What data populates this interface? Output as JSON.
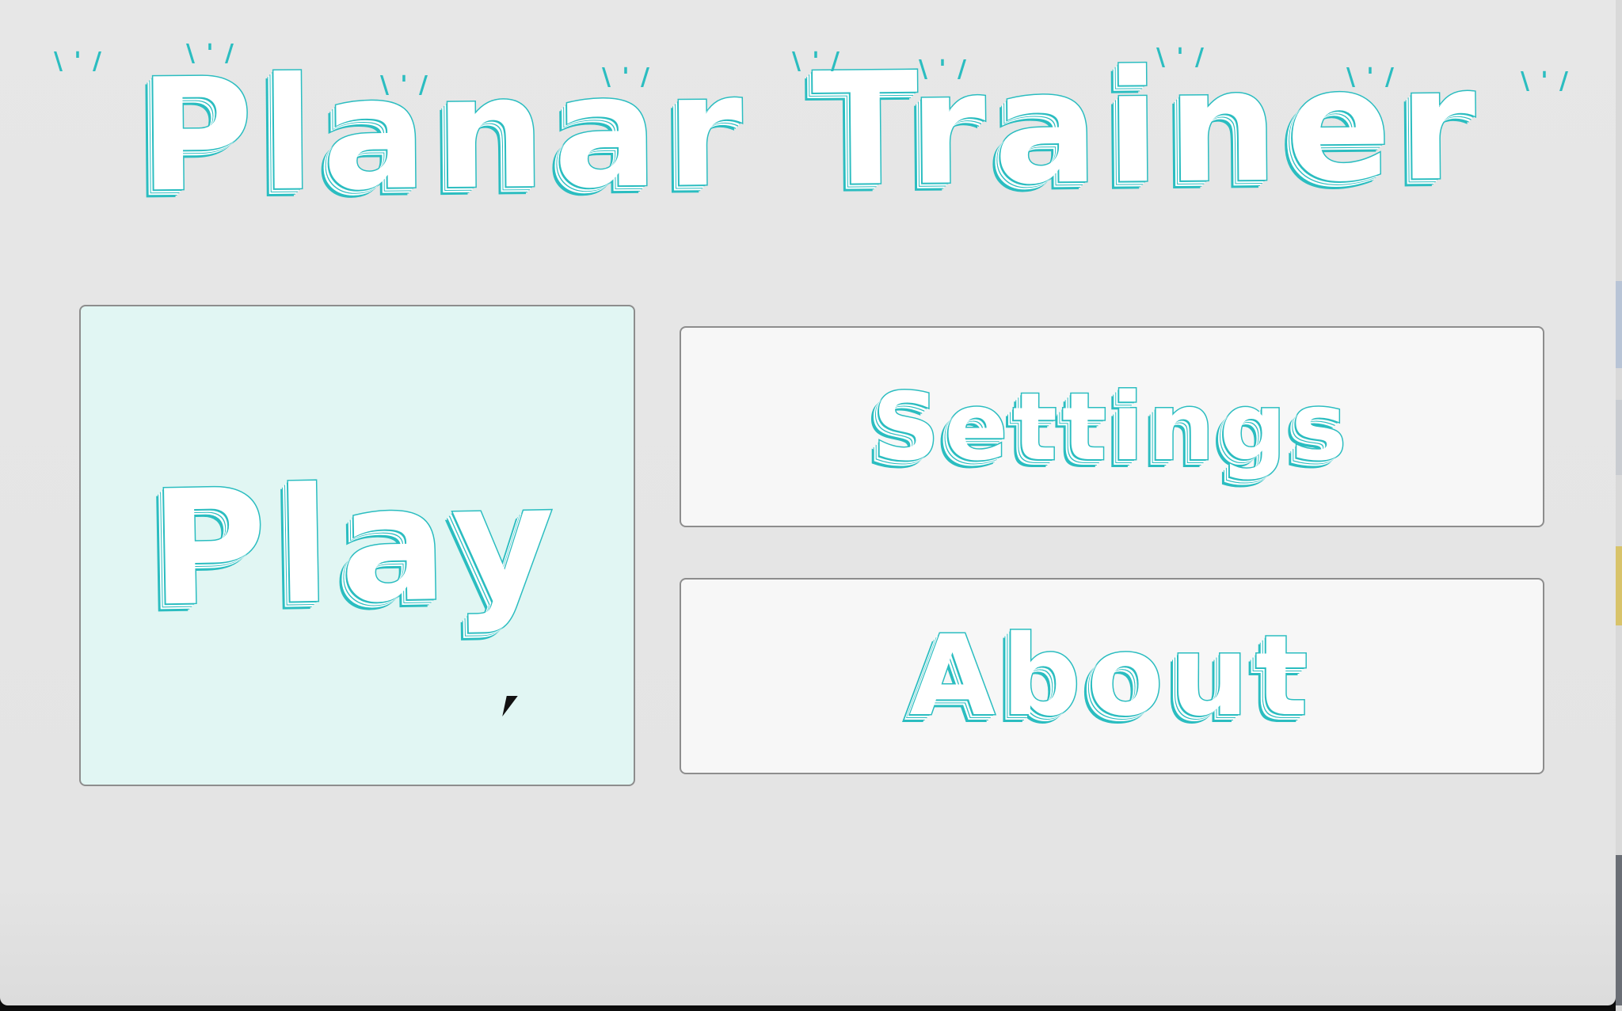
{
  "app": {
    "title": "Planar Trainer"
  },
  "menu": {
    "play_label": "Play",
    "settings_label": "Settings",
    "about_label": "About",
    "hovered": "play"
  },
  "colors": {
    "accent": "#2bbdc0",
    "background": "#e5e5e5",
    "button_face": "#f7f7f7",
    "button_hover": "#e1f6f3",
    "button_border": "#8d8d8d"
  },
  "icons": {
    "pointer": "arrow-cursor-icon"
  }
}
